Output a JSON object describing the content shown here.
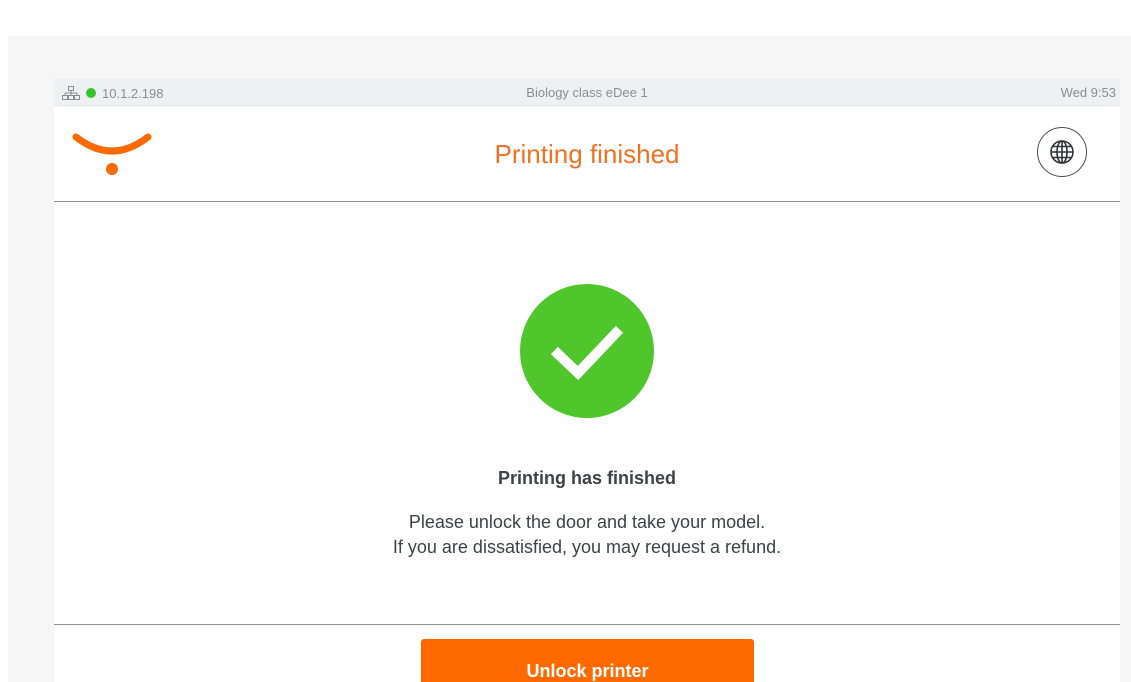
{
  "status_bar": {
    "ip_address": "10.1.2.198",
    "device_name": "Biology class eDee 1",
    "clock": "Wed 9:53",
    "connection_color": "#35c429"
  },
  "header": {
    "title": "Printing finished",
    "logo_icon": "smile-logo-icon",
    "language_icon": "globe-icon"
  },
  "message": {
    "icon": "checkmark-icon",
    "title": "Printing has finished",
    "line1": "Please unlock the door and take your model.",
    "line2": "If you are dissatisfied, you may request a refund."
  },
  "actions": {
    "unlock_label": "Unlock printer"
  },
  "colors": {
    "accent": "#ff6a00",
    "title": "#f37021",
    "success": "#4fc62c"
  }
}
